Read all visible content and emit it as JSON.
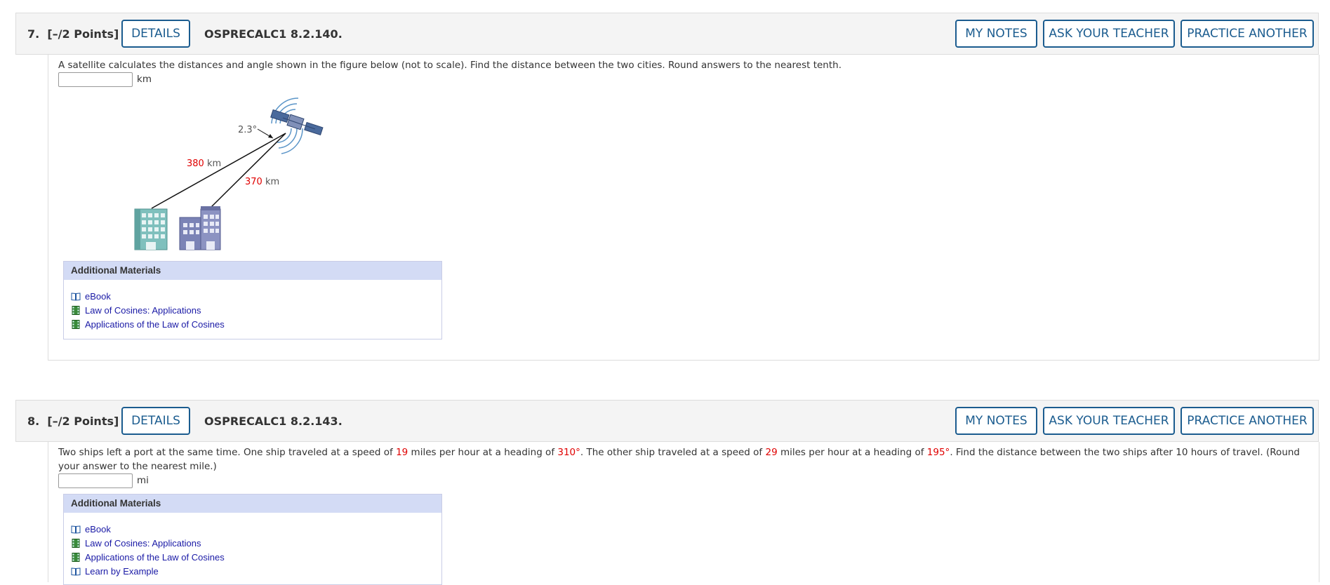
{
  "questions": [
    {
      "number": "7.",
      "points": "[–/2 Points]",
      "details_label": "DETAILS",
      "code": "OSPRECALC1 8.2.140.",
      "my_notes_label": "MY NOTES",
      "ask_teacher_label": "ASK YOUR TEACHER",
      "practice_label": "PRACTICE ANOTHER",
      "prompt": "A satellite calculates the distances and angle shown in the figure below (not to scale). Find the distance between the two cities. Round answers to the nearest tenth.",
      "unit": "km",
      "figure": {
        "angle_value": "2.3°",
        "side1_value": "380",
        "side1_unit": "km",
        "side2_value": "370",
        "side2_unit": "km"
      },
      "materials_title": "Additional Materials",
      "materials": [
        {
          "label": "eBook",
          "icon": "ebook-icon"
        },
        {
          "label": "Law of Cosines: Applications",
          "icon": "video-icon"
        },
        {
          "label": "Applications of the Law of Cosines",
          "icon": "video-icon"
        }
      ]
    },
    {
      "number": "8.",
      "points": "[–/2 Points]",
      "details_label": "DETAILS",
      "code": "OSPRECALC1 8.2.143.",
      "my_notes_label": "MY NOTES",
      "ask_teacher_label": "ASK YOUR TEACHER",
      "practice_label": "PRACTICE ANOTHER",
      "prompt_parts": {
        "p1": "Two ships left a port at the same time. One ship traveled at a speed of ",
        "v1": "19",
        "p2": " miles per hour at a heading of ",
        "v2": "310°",
        "p3": ". The other ship traveled at a speed of ",
        "v3": "29",
        "p4": " miles per hour at a heading of ",
        "v4": "195°",
        "p5": ". Find the distance between the two ships after 10 hours of travel. (Round your answer to the nearest mile.)"
      },
      "unit": "mi",
      "materials_title": "Additional Materials",
      "materials": [
        {
          "label": "eBook",
          "icon": "ebook-icon"
        },
        {
          "label": "Law of Cosines: Applications",
          "icon": "video-icon"
        },
        {
          "label": "Applications of the Law of Cosines",
          "icon": "video-icon"
        },
        {
          "label": "Learn by Example",
          "icon": "ebook-icon"
        }
      ]
    }
  ],
  "colors": {
    "accent": "#1b5c8f",
    "value_red": "#e00000",
    "link": "#1a1aa6",
    "materials_header": "#d3dbf5"
  }
}
